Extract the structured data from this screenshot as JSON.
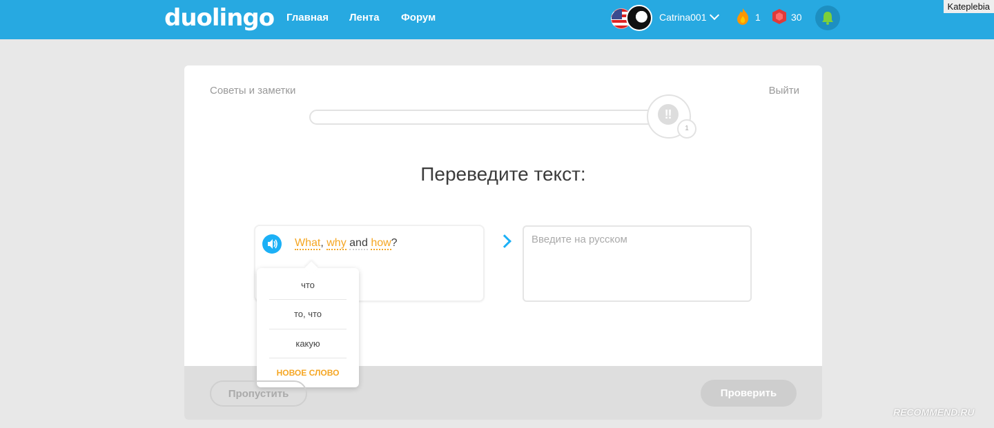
{
  "header": {
    "logo": "duolingo",
    "nav": [
      "Главная",
      "Лента",
      "Форум"
    ],
    "username": "Catrina001",
    "streak": "1",
    "gems": "30",
    "watermark": "Kateplebia"
  },
  "lesson": {
    "tips_label": "Советы и заметки",
    "quit_label": "Выйти",
    "progress_badge": "1",
    "prompt": "Переведите текст:",
    "sentence": {
      "w1": "What",
      "p1": ",",
      "w2": "why",
      "w3": "and",
      "w4": "how",
      "p2": "?"
    },
    "answer_placeholder": "Введите на русском",
    "hints": [
      "что",
      "то, что",
      "какую"
    ],
    "new_word": "НОВОЕ СЛОВО",
    "skip_label": "Пропустить",
    "check_label": "Проверить"
  },
  "colors": {
    "header": "#27a9e1",
    "accent": "#1cb0f6",
    "hint": "#f5a623"
  },
  "footer_watermark": "RECOMMEND.RU"
}
